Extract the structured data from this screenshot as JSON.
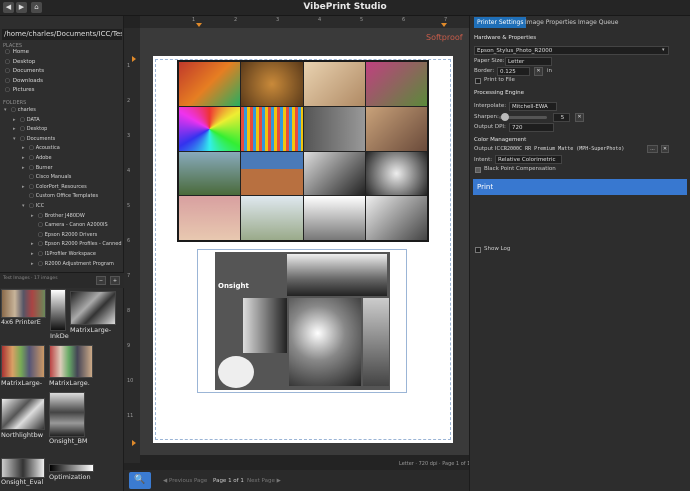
{
  "app": {
    "title": "VibePrint Studio"
  },
  "toolbar": {
    "back": "◀",
    "forward": "▶",
    "home": "⌂"
  },
  "sidebar": {
    "path": "/home/charles/Documents/ICC/Test Images",
    "places_header": "PLACES",
    "places": [
      "Home",
      "Desktop",
      "Documents",
      "Downloads",
      "Pictures"
    ],
    "folders_header": "FOLDERS",
    "tree": [
      {
        "label": "charles",
        "depth": 0,
        "arrow": "▾"
      },
      {
        "label": "DATA",
        "depth": 1,
        "arrow": "▸"
      },
      {
        "label": "Desktop",
        "depth": 1,
        "arrow": "▸"
      },
      {
        "label": "Documents",
        "depth": 1,
        "arrow": "▾"
      },
      {
        "label": "Acoustica",
        "depth": 2,
        "arrow": "▸"
      },
      {
        "label": "Adobe",
        "depth": 2,
        "arrow": "▸"
      },
      {
        "label": "Burner",
        "depth": 2,
        "arrow": "▸"
      },
      {
        "label": "Cisco Manuals",
        "depth": 2,
        "arrow": ""
      },
      {
        "label": "ColorPort_Resources",
        "depth": 2,
        "arrow": "▸"
      },
      {
        "label": "Custom Office Templates",
        "depth": 2,
        "arrow": ""
      },
      {
        "label": "ICC",
        "depth": 2,
        "arrow": "▾"
      },
      {
        "label": "Brother J480DW",
        "depth": 3,
        "arrow": "▸"
      },
      {
        "label": "Camera - Canon A2000IS",
        "depth": 3,
        "arrow": ""
      },
      {
        "label": "Epson R2000 Drivers",
        "depth": 3,
        "arrow": ""
      },
      {
        "label": "Epson R2000 Profiles - Canned",
        "depth": 3,
        "arrow": "▸"
      },
      {
        "label": "I1Profiler Workspace",
        "depth": 3,
        "arrow": "▸"
      },
      {
        "label": "R2000 Adjustment Program",
        "depth": 3,
        "arrow": "▸"
      }
    ],
    "thumb_header": "Test Images · 17 images",
    "thumb_minus": "−",
    "thumb_plus": "+",
    "thumbs": [
      "4x6 PrinterE",
      "InkDe",
      "MatrixLarge-",
      "MatrixLarge-",
      "MatrixLarge.",
      "Northlightbw",
      "Onsight_BM",
      "Onsight_Eval",
      "Optimization"
    ]
  },
  "viewer": {
    "softproof": "Softproof",
    "status": "Letter · 720 dpi · Page 1 of 1",
    "zoom_icon": "🔍",
    "prev": "◀ Previous Page",
    "page_of": "Page 1 of 1",
    "next": "Next Page ▶",
    "ruler_h": [
      "1",
      "2",
      "3",
      "4",
      "5",
      "6",
      "7"
    ],
    "ruler_v": [
      "1",
      "2",
      "3",
      "4",
      "5",
      "6",
      "7",
      "8",
      "9",
      "10",
      "11"
    ],
    "onsight_label": "Onsight"
  },
  "right": {
    "tabs": [
      "Printer Settings",
      "Image Properties",
      "Image Queue"
    ],
    "hw_header": "Hardware & Properties",
    "printer": "Epson_Stylus_Photo_R2000",
    "paper_label": "Paper Size:",
    "paper": "Letter",
    "border_label": "Border:",
    "border": "0.125",
    "border_unit": "in",
    "print_to_file": "Print to File",
    "engine_header": "Processing Engine",
    "interp_label": "Interpolate:",
    "interp": "Mitchell-EWA",
    "sharpen_label": "Sharpen:",
    "sharpen": "5",
    "sharpen_level": 0.12,
    "dpi_label": "Output DPI:",
    "dpi": "720",
    "cm_header": "Color Management",
    "output_icc_label": "Output ICC:",
    "output_icc": "R2000C RR Premium Matte (MPH-SuperPhoto)",
    "dots": "...",
    "intent_label": "Intent:",
    "intent": "Relative Colorimetric",
    "bpc": "Black Point Compensation",
    "print": "Print",
    "show_log": "Show Log"
  },
  "colors": {
    "accent": "#3878d0",
    "softproof": "#c85c4a"
  }
}
